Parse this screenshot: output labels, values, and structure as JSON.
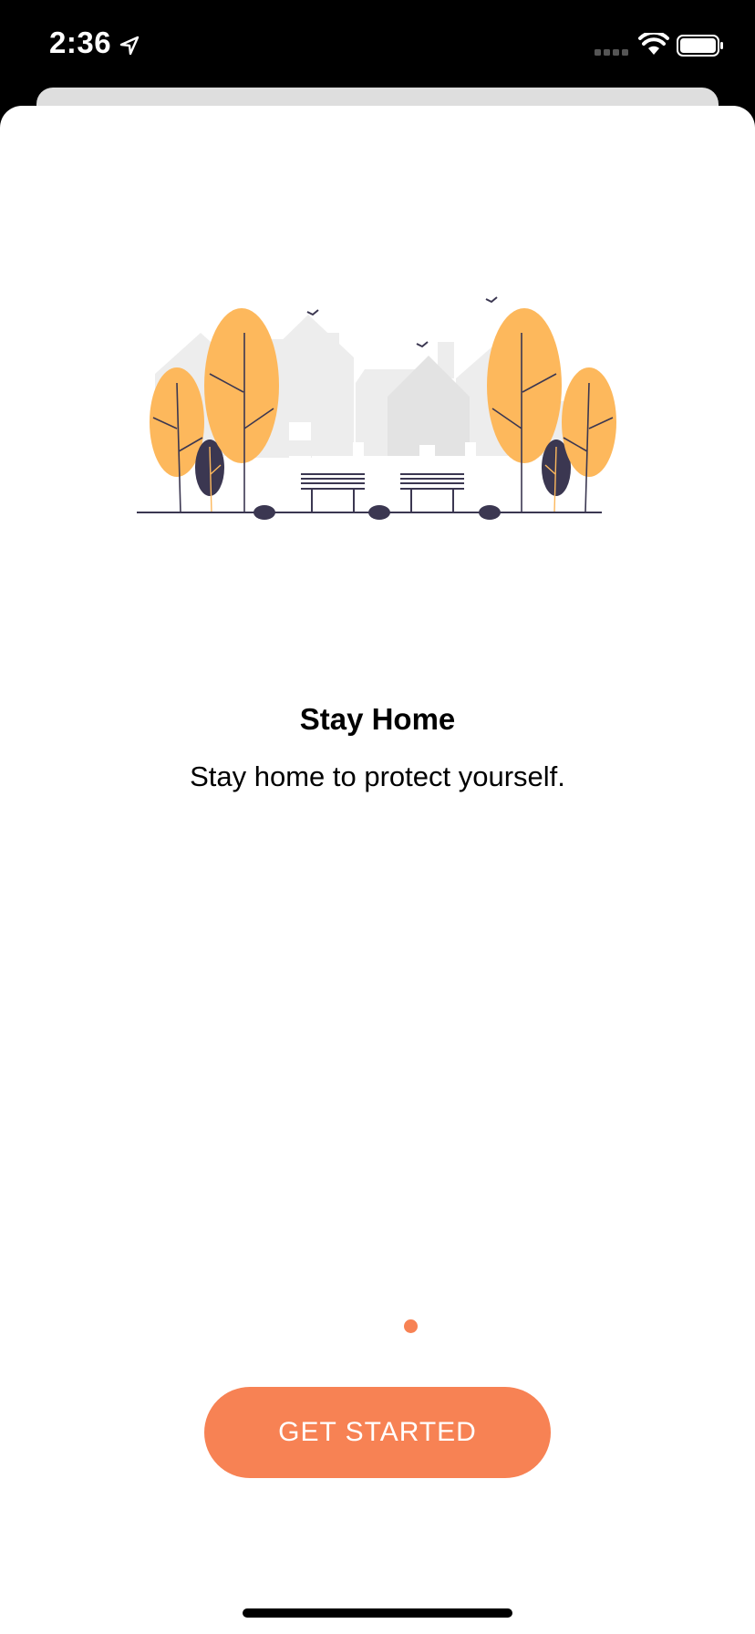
{
  "status_bar": {
    "time": "2:36",
    "icons": [
      "location-arrow-icon",
      "signal-icon",
      "wifi-icon",
      "battery-icon"
    ]
  },
  "onboarding": {
    "illustration": "city-park-illustration",
    "title": "Stay Home",
    "subtitle": "Stay home to protect yourself.",
    "page_indicator": {
      "pages": 1,
      "current": 1
    },
    "cta_label": "GET STARTED"
  },
  "colors": {
    "accent": "#f78254",
    "tree_yellow": "#fdb85c",
    "tree_dark": "#3b3751",
    "building_gray": "#e6e6e6",
    "background": "#ffffff"
  }
}
